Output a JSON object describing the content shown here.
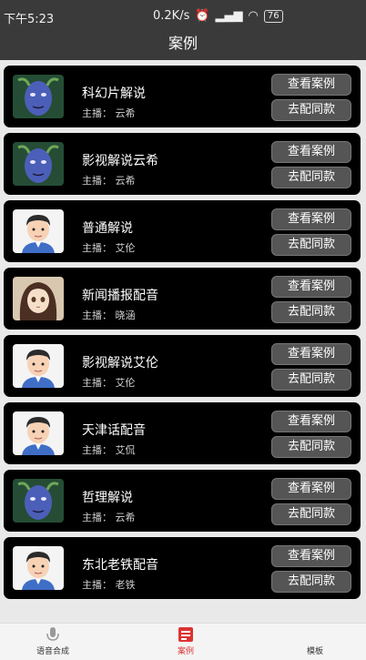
{
  "status": {
    "time": "下午5:23",
    "speed": "0.2K/s",
    "battery": "76"
  },
  "header": {
    "title": "案例"
  },
  "cards": [
    {
      "name": "科幻片解说",
      "host": "主播：  云希",
      "avatar": "blue-face",
      "view_label": "查看案例",
      "copy_label": "去配同款"
    },
    {
      "name": "影视解说云希",
      "host": "主播：  云希",
      "avatar": "blue-face",
      "view_label": "查看案例",
      "copy_label": "去配同款"
    },
    {
      "name": "普通解说",
      "host": "主播：  艾伦",
      "avatar": "man-cartoon",
      "view_label": "查看案例",
      "copy_label": "去配同款"
    },
    {
      "name": "新闻播报配音",
      "host": "主播：  晓涵",
      "avatar": "anime-girl",
      "view_label": "查看案例",
      "copy_label": "去配同款"
    },
    {
      "name": "影视解说艾伦",
      "host": "主播：  艾伦",
      "avatar": "man-cartoon",
      "view_label": "查看案例",
      "copy_label": "去配同款"
    },
    {
      "name": "天津话配音",
      "host": "主播：  艾侃",
      "avatar": "man-cartoon",
      "view_label": "查看案例",
      "copy_label": "去配同款"
    },
    {
      "name": "哲理解说",
      "host": "主播：  云希",
      "avatar": "blue-face",
      "view_label": "查看案例",
      "copy_label": "去配同款"
    },
    {
      "name": "东北老铁配音",
      "host": "主播：  老铁",
      "avatar": "man-cartoon",
      "view_label": "查看案例",
      "copy_label": "去配同款"
    }
  ],
  "tabs": [
    {
      "label": "语音合成",
      "icon": "mic-icon"
    },
    {
      "label": "案例",
      "icon": "case-icon"
    },
    {
      "label": "模板",
      "icon": "template-icon"
    }
  ],
  "colors": {
    "accent": "#d33333",
    "card": "#000000",
    "button": "#555555"
  }
}
